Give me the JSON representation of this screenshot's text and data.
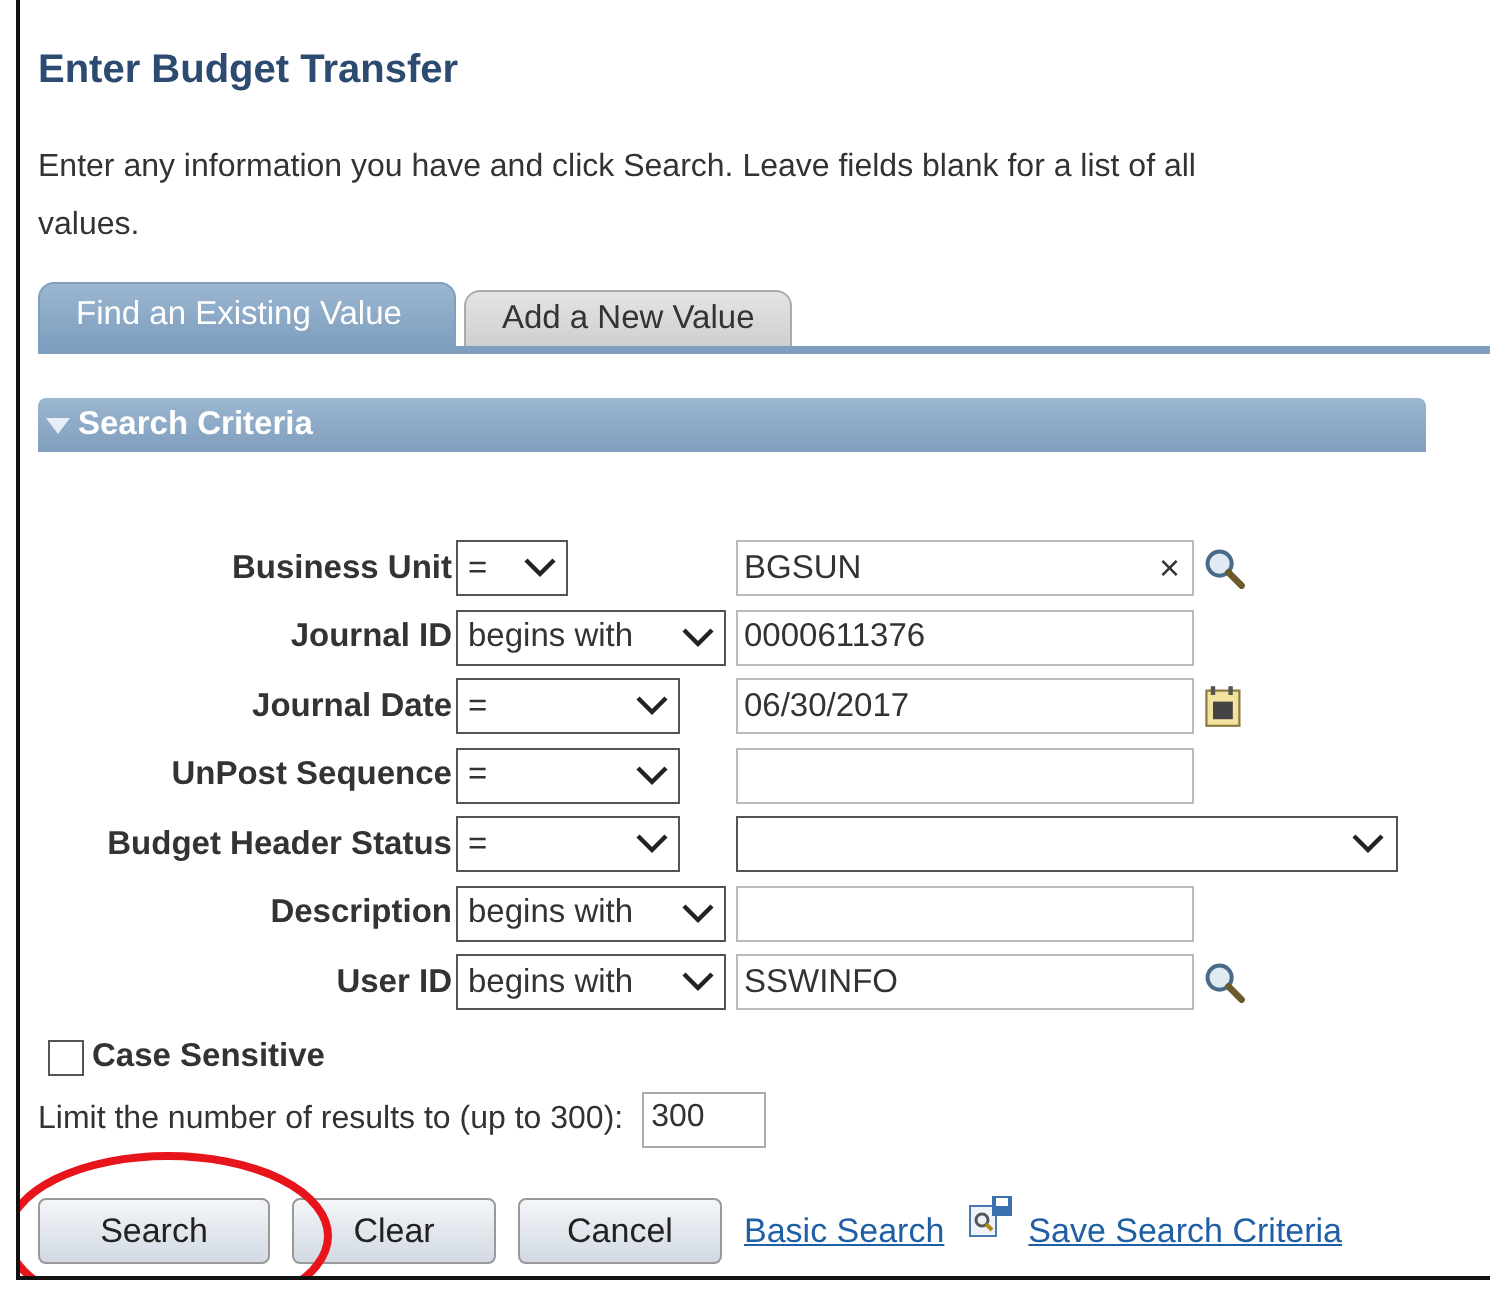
{
  "page_title": "Enter Budget Transfer",
  "instructions": "Enter any information you have and click Search. Leave fields blank for a list of all values.",
  "tabs": [
    {
      "label": "Find an Existing Value",
      "selected": true
    },
    {
      "label": "Add a New Value",
      "selected": false
    }
  ],
  "section": {
    "title": "Search Criteria",
    "expanded": true
  },
  "criteria": [
    {
      "label": "Business Unit",
      "operator": {
        "text": "=",
        "kind": "short"
      },
      "kind": "lookup",
      "value": "BGSUN",
      "clear": "×"
    },
    {
      "label": "Journal ID",
      "operator": {
        "text": "begins with",
        "kind": "wide"
      },
      "kind": "text",
      "value": "0000611376"
    },
    {
      "label": "Journal Date",
      "operator": {
        "text": "=",
        "kind": "normal"
      },
      "kind": "date",
      "value": "06/30/2017"
    },
    {
      "label": "UnPost Sequence",
      "operator": {
        "text": "=",
        "kind": "normal"
      },
      "kind": "text"
    },
    {
      "label": "Budget Header Status",
      "operator": {
        "text": "=",
        "kind": "normal"
      },
      "kind": "select"
    },
    {
      "label": "Description",
      "operator": {
        "text": "begins with",
        "kind": "wide"
      },
      "kind": "text"
    },
    {
      "label": "User ID",
      "operator": {
        "text": "begins with",
        "kind": "wide"
      },
      "kind": "lookup",
      "value": "SSWINFO"
    }
  ],
  "case_sensitive": {
    "label": "Case Sensitive",
    "checked": false
  },
  "limit": {
    "label": "Limit the number of results to (up to 300):",
    "value": "300"
  },
  "buttons": [
    "Search",
    "Clear",
    "Cancel"
  ],
  "links": [
    {
      "label": "Basic Search",
      "kind": "plain"
    },
    {
      "label": "Save Search Criteria",
      "kind": "save"
    }
  ]
}
